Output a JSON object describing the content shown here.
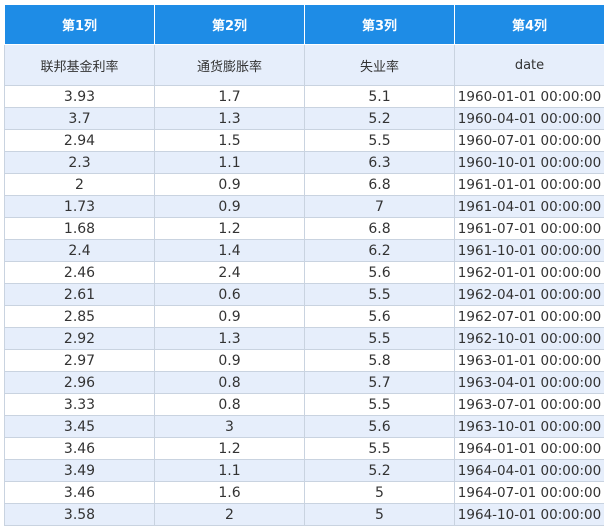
{
  "table": {
    "header": [
      "第1列",
      "第2列",
      "第3列",
      "第4列"
    ],
    "field_names": [
      "联邦基金利率",
      "通货膨胀率",
      "失业率",
      "date"
    ],
    "rows": [
      [
        "3.93",
        "1.7",
        "5.1",
        "1960-01-01 00:00:00"
      ],
      [
        "3.7",
        "1.3",
        "5.2",
        "1960-04-01 00:00:00"
      ],
      [
        "2.94",
        "1.5",
        "5.5",
        "1960-07-01 00:00:00"
      ],
      [
        "2.3",
        "1.1",
        "6.3",
        "1960-10-01 00:00:00"
      ],
      [
        "2",
        "0.9",
        "6.8",
        "1961-01-01 00:00:00"
      ],
      [
        "1.73",
        "0.9",
        "7",
        "1961-04-01 00:00:00"
      ],
      [
        "1.68",
        "1.2",
        "6.8",
        "1961-07-01 00:00:00"
      ],
      [
        "2.4",
        "1.4",
        "6.2",
        "1961-10-01 00:00:00"
      ],
      [
        "2.46",
        "2.4",
        "5.6",
        "1962-01-01 00:00:00"
      ],
      [
        "2.61",
        "0.6",
        "5.5",
        "1962-04-01 00:00:00"
      ],
      [
        "2.85",
        "0.9",
        "5.6",
        "1962-07-01 00:00:00"
      ],
      [
        "2.92",
        "1.3",
        "5.5",
        "1962-10-01 00:00:00"
      ],
      [
        "2.97",
        "0.9",
        "5.8",
        "1963-01-01 00:00:00"
      ],
      [
        "2.96",
        "0.8",
        "5.7",
        "1963-04-01 00:00:00"
      ],
      [
        "3.33",
        "0.8",
        "5.5",
        "1963-07-01 00:00:00"
      ],
      [
        "3.45",
        "3",
        "5.6",
        "1963-10-01 00:00:00"
      ],
      [
        "3.46",
        "1.2",
        "5.5",
        "1964-01-01 00:00:00"
      ],
      [
        "3.49",
        "1.1",
        "5.2",
        "1964-04-01 00:00:00"
      ],
      [
        "3.46",
        "1.6",
        "5",
        "1964-07-01 00:00:00"
      ],
      [
        "3.58",
        "2",
        "5",
        "1964-10-01 00:00:00"
      ]
    ]
  },
  "colors": {
    "header_bg": "#1e8ce6",
    "header_text": "#ffffff",
    "stripe_bg": "#e6eefb",
    "border": "#c9d3e0",
    "text": "#333333"
  }
}
